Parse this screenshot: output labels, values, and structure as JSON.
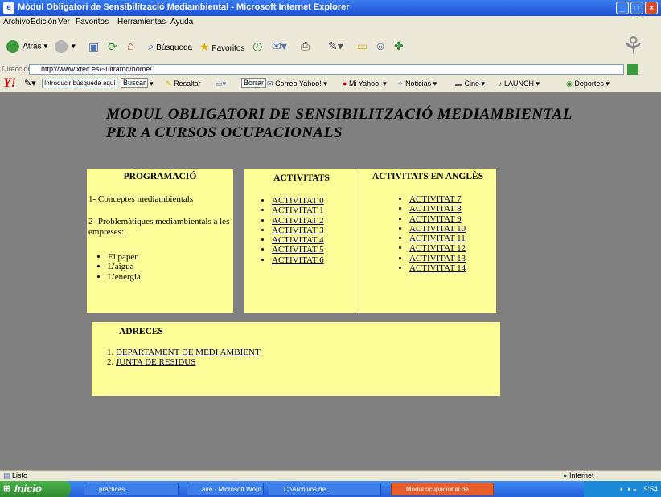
{
  "window": {
    "title": "Mòdul Obligatori de Sensibilització Mediambiental - Microsoft Internet Explorer"
  },
  "menubar": {
    "items": [
      "Archivo",
      "Edición",
      "Ver",
      "Favoritos",
      "Herramientas",
      "Ayuda"
    ]
  },
  "toolbar": {
    "back_label": "Atrás",
    "search_label": "Búsqueda",
    "favorites_label": "Favoritos"
  },
  "address": {
    "label": "Dirección",
    "url": "http://www.xtec.es/~ultramd/home/"
  },
  "yahoo": {
    "logo": "Y!",
    "search_placeholder": "Introducir búsqueda aquí",
    "buscar_label": "Buscar",
    "resaltar_label": "Resaltar",
    "borrar_label": "Borrar",
    "correo_label": "Correo Yahoo!",
    "mi_yahoo_label": "Mi Yahoo!",
    "noticias_label": "Noticias",
    "cine_label": "Cine",
    "launch_label": "LAUNCH",
    "deportes_label": "Deportes"
  },
  "page": {
    "title_line1": "MODUL OBLIGATORI DE SENSIBILITZACIÓ MEDIAMBIENTAL",
    "title_line2": "PER A CURSOS OCUPACIONALS",
    "programacio": {
      "heading": "PROGRAMACIÓ",
      "item1": "1- Conceptes mediambientals",
      "item2": "2- Problemàtiques mediambientals a les empreses:",
      "subitems": [
        "El paper",
        "L'aigua",
        "L'energia"
      ]
    },
    "activitats": {
      "heading": "ACTIVITATS",
      "links": [
        "ACTIVITAT 0",
        "ACTIVITAT 1",
        "ACTIVITAT 2",
        "ACTIVITAT 3",
        "ACTIVITAT 4",
        "ACTIVITAT 5",
        "ACTIVITAT 6"
      ]
    },
    "activitats_angles": {
      "heading": "ACTIVITATS EN ANGLÈS",
      "links": [
        "ACTIVITAT 7",
        "ACTIVITAT 8",
        "ACTIVITAT 9",
        "ACTIVITAT 10",
        "ACTIVITAT 11",
        "ACTIVITAT 12",
        "ACTIVITAT 13",
        "ACTIVITAT 14"
      ]
    },
    "adreces": {
      "heading": "ADRECES",
      "links": [
        "DEPARTAMENT DE MEDI AMBIENT",
        "JUNTA DE RESIDUS"
      ]
    }
  },
  "statusbar": {
    "left": "Listo",
    "zone": "Internet"
  },
  "taskbar": {
    "start_label": "Inicio",
    "tasks": [
      "prácticas",
      "aire - Microsoft Word",
      "C:\\Archivos de...",
      "Mòdul ocupacional de..."
    ],
    "clock": "9:54"
  },
  "colors": {
    "page_bg": "#808080",
    "panel_bg": "#ffff99",
    "link": "#000060"
  }
}
